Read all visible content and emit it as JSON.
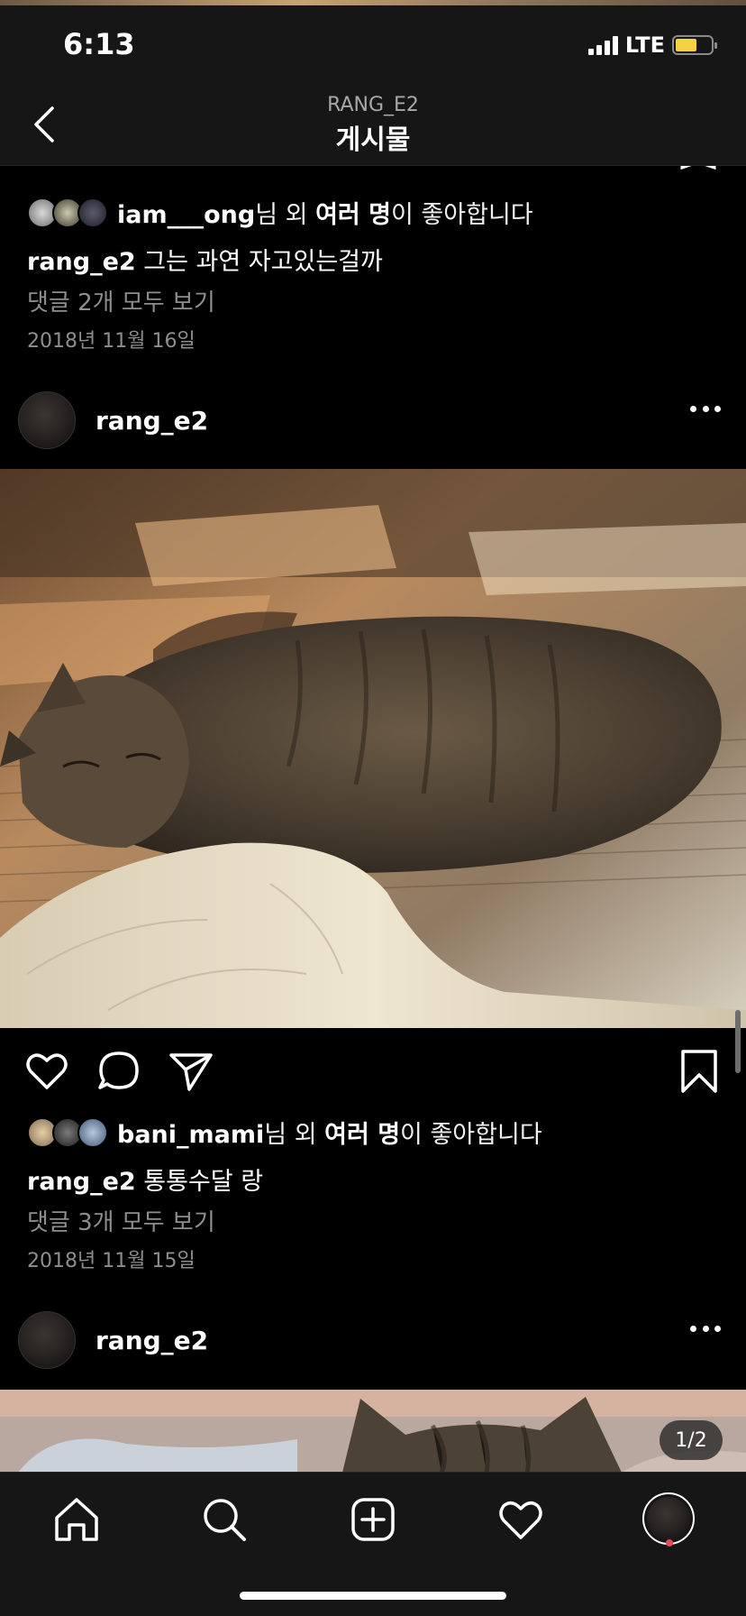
{
  "status_bar": {
    "time": "6:13",
    "network": "LTE"
  },
  "header": {
    "subtitle": "RANG_E2",
    "title": "게시물"
  },
  "post_prev": {
    "likes": {
      "first_liker": "iam___ong",
      "suffix_1": "님 외 ",
      "others": "여러 명",
      "suffix_2": "이 좋아합니다"
    },
    "caption_user": "rang_e2",
    "caption_text": "그는 과연 자고있는걸까",
    "comments_link": "댓글 2개 모두 보기",
    "date": "2018년 11월 16일"
  },
  "post_main": {
    "username": "rang_e2",
    "likes": {
      "first_liker": "bani_mami",
      "suffix_1": "님 외 ",
      "others": "여러 명",
      "suffix_2": "이 좋아합니다"
    },
    "caption_user": "rang_e2",
    "caption_text": "통통수달 랑",
    "comments_link": "댓글 3개 모두 보기",
    "date": "2018년 11월 15일"
  },
  "post_next": {
    "username": "rang_e2",
    "carousel_counter": "1/2"
  },
  "tab_bar": {
    "items": [
      "home-icon",
      "search-icon",
      "add-post-icon",
      "activity-heart-icon",
      "profile-avatar"
    ]
  },
  "colors": {
    "background": "#000000",
    "bar": "#161616",
    "muted_text": "#8e8e8e",
    "notification": "#ed4956",
    "battery": "#f7d144"
  }
}
